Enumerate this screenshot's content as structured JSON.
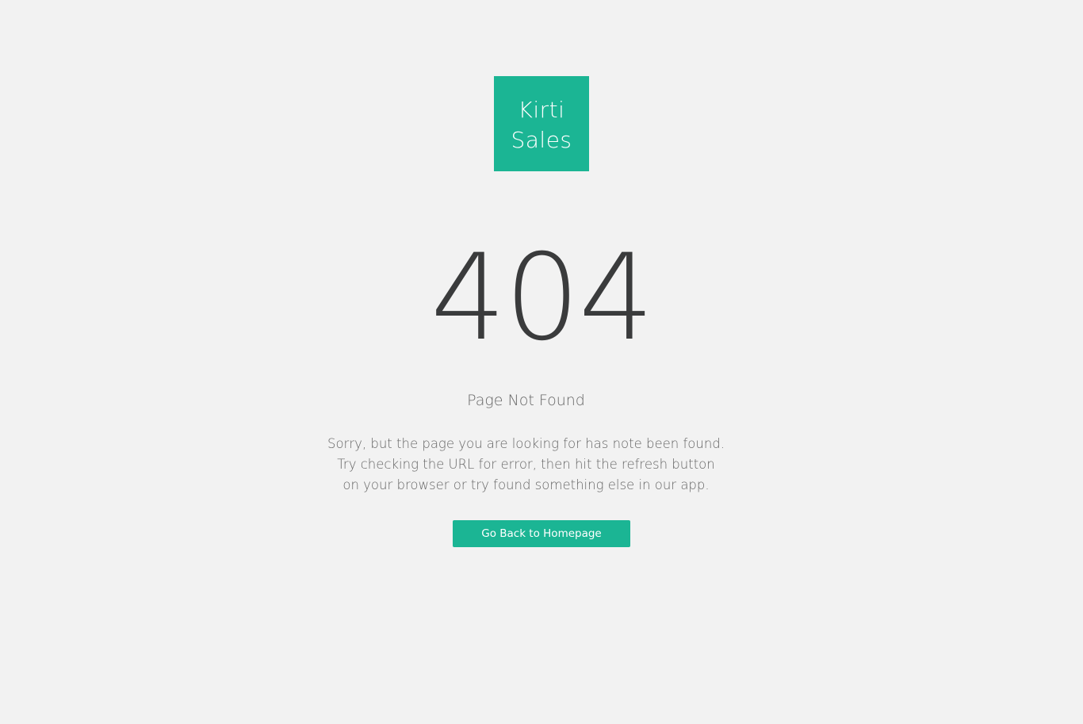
{
  "brand": {
    "logo_line1": "Kirti",
    "logo_line2": "Sales",
    "color": "#1bb594"
  },
  "error": {
    "code": "404",
    "title": "Page Not Found",
    "message_lines": [
      "Sorry, but the page you are looking for has note been found.",
      "Try checking the URL for error, then hit the refresh button",
      "on your browser or try found something else in our app."
    ]
  },
  "actions": {
    "home_button_label": "Go Back to Homepage"
  }
}
